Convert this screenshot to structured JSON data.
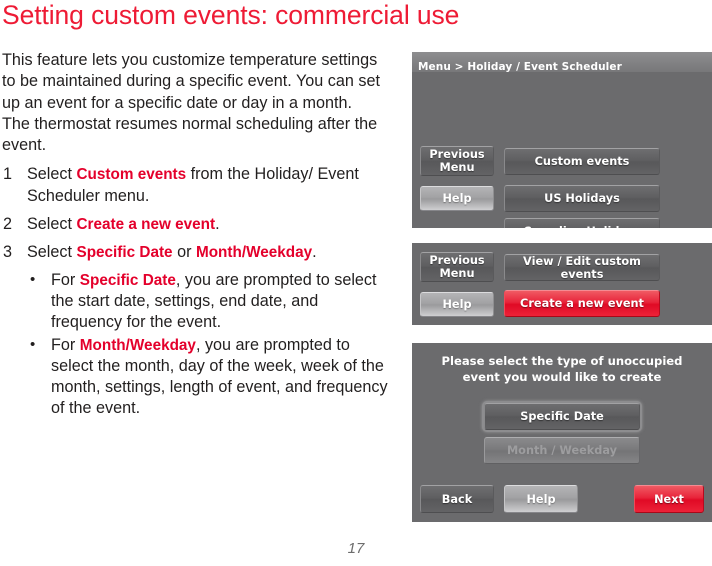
{
  "page_title": "Setting custom events: commercial use",
  "page_number": "17",
  "intro_paragraph": "This feature lets you customize temperature settings to be maintained during a specific event. You can set up an event for a specific date or day in a month. The thermostat resumes normal scheduling after the event.",
  "steps": [
    {
      "num": "1",
      "pre": "Select ",
      "hl": "Custom events",
      "post": " from the Holiday/ Event Scheduler menu."
    },
    {
      "num": "2",
      "pre": "Select ",
      "hl": "Create a new event",
      "post": "."
    },
    {
      "num": "3",
      "pre": "Select ",
      "hl": "Specific Date",
      "mid": " or ",
      "hl2": "Month/Weekday",
      "post": ".",
      "subbullets": [
        {
          "bullet": "•",
          "pre": "For ",
          "hl": "Specific Date",
          "post": ", you are prompted to select the start date, settings, end date, and frequency for the event."
        },
        {
          "bullet": "•",
          "pre": "For ",
          "hl": "Month/Weekday",
          "post": ", you are prompted to select the month, day of the week, week of the month, settings, length of event, and frequency of the event."
        }
      ]
    }
  ],
  "screens": [
    {
      "id": "screen1",
      "breadcrumb": "Menu > Holiday / Event Scheduler",
      "buttons": {
        "previous_menu": "Previous Menu",
        "help": "Help",
        "custom_events": "Custom events",
        "us_holidays": "US Holidays",
        "canadian_holidays": "Canadian Holidays"
      }
    },
    {
      "id": "screen2",
      "buttons": {
        "previous_menu": "Previous Menu",
        "help": "Help",
        "view_edit": "View / Edit custom events",
        "create_new": "Create a new event"
      }
    },
    {
      "id": "screen3",
      "prompt": "Please select the type of unoccupied event you would like to create",
      "buttons": {
        "specific_date": "Specific Date",
        "month_weekday": "Month / Weekday",
        "back": "Back",
        "help": "Help",
        "next": "Next"
      }
    }
  ],
  "colors": {
    "title_red": "#ee1b35",
    "highlight_red": "#e4002b",
    "body_text": "#221f1f",
    "screen_bg": "#6b6b6d",
    "screen_header": "#828284",
    "action_red": "#e8243a"
  }
}
